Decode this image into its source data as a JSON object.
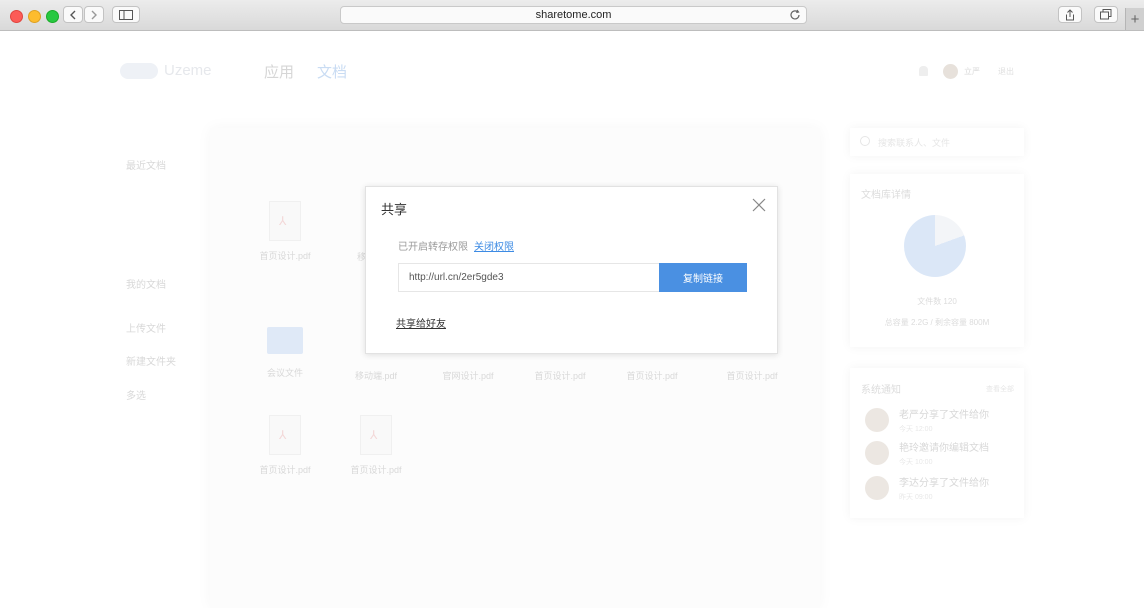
{
  "browser": {
    "url": "sharetome.com"
  },
  "header": {
    "logo_text": "Uzeme",
    "nav": [
      "应用",
      "文档"
    ],
    "user_name": "立严",
    "logout": "退出"
  },
  "sidebar": {
    "recent": "最近文档",
    "mine": "我的文档",
    "actions": [
      "上传文件",
      "新建文件夹",
      "多选"
    ]
  },
  "files_row1": [
    "首页设计.pdf",
    "移"
  ],
  "files_row2": [
    "会议文件",
    "移动端.pdf",
    "官网设计.pdf",
    "首页设计.pdf",
    "首页设计.pdf",
    "首页设计.pdf"
  ],
  "files_row3": [
    "首页设计.pdf",
    "首页设计.pdf"
  ],
  "right": {
    "search_placeholder": "搜索联系人、文件",
    "library_title": "文档库详情",
    "file_count": "文件数 120",
    "capacity": "总容量 2.2G / 剩余容量 800M",
    "notice_title": "系统通知",
    "notice_more": "查看全部",
    "notices": [
      {
        "text": "老严分享了文件给你",
        "time": "今天 12:00"
      },
      {
        "text": "艳玲邀请你编辑文档",
        "time": "今天 10:00"
      },
      {
        "text": "李达分享了文件给你",
        "time": "昨天 09:00"
      }
    ]
  },
  "modal": {
    "title": "共享",
    "status": "已开启转存权限",
    "toggle_link": "关闭权限",
    "share_url": "http://url.cn/2er5gde3",
    "copy_button": "复制链接",
    "share_friends": "共享给好友"
  }
}
